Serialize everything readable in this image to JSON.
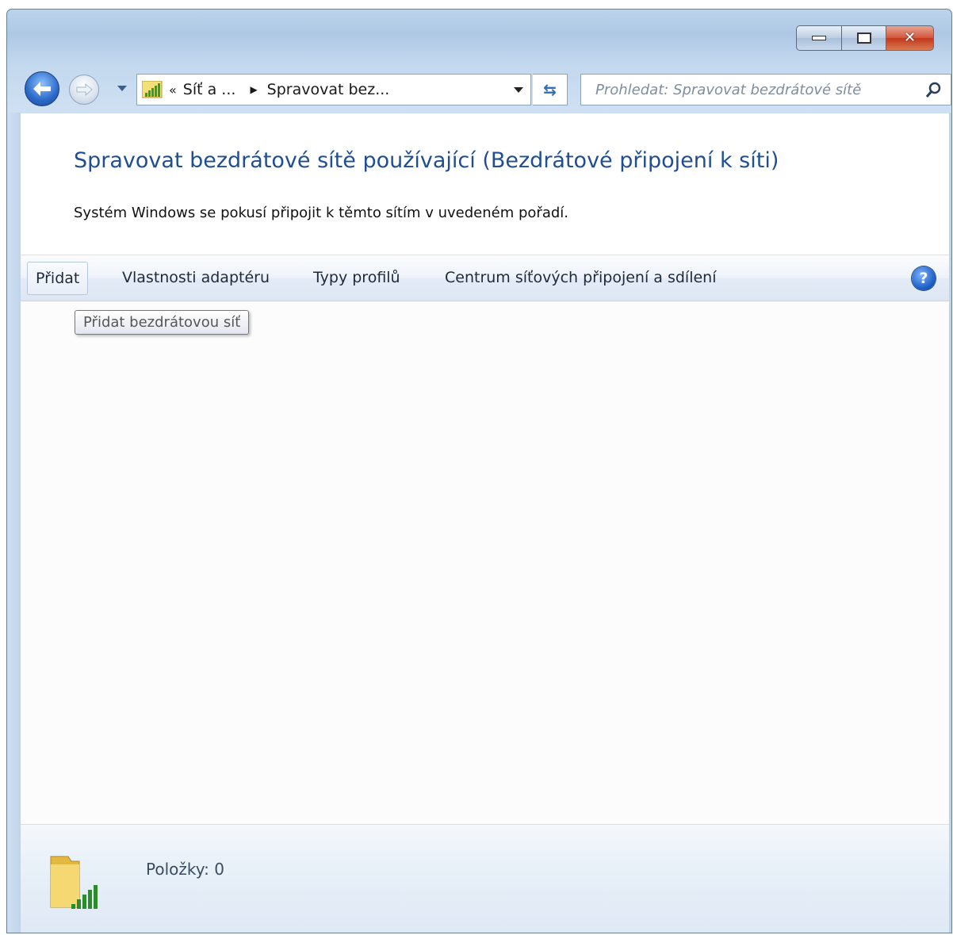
{
  "window": {
    "caption_buttons": {
      "minimize_icon": "minimize-icon",
      "maximize_icon": "maximize-icon",
      "close_icon": "close-icon",
      "close_glyph": "✕"
    }
  },
  "nav": {
    "back_icon": "back-arrow-icon",
    "forward_icon": "forward-arrow-icon",
    "breadcrumb": {
      "chevron": "«",
      "items": [
        "Síť a ...",
        "Spravovat bez..."
      ]
    },
    "refresh_glyph": "⇆",
    "search": {
      "placeholder": "Prohledat: Spravovat bezdrátové sítě"
    }
  },
  "header": {
    "title": "Spravovat bezdrátové sítě používající (Bezdrátové připojení k síti)",
    "description": "Systém Windows se pokusí připojit k těmto sítím v uvedeném pořadí."
  },
  "toolbar": {
    "items": [
      "Přidat",
      "Vlastnosti adaptéru",
      "Typy profilů",
      "Centrum síťových připojení a sdílení"
    ],
    "help_glyph": "?"
  },
  "tooltip": {
    "text": "Přidat bezdrátovou síť"
  },
  "status": {
    "items_count": "Položky: 0"
  },
  "colors": {
    "title": "#1f4e93",
    "accent": "#2b69c8",
    "signal": "#2ea02e"
  }
}
